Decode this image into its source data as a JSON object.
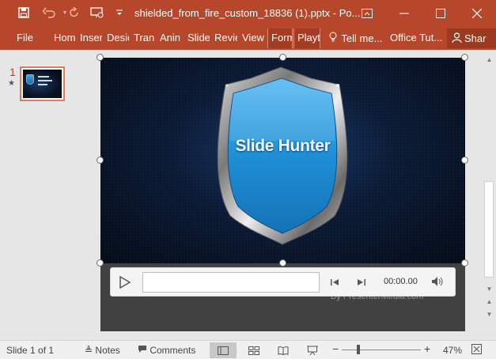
{
  "titlebar": {
    "title": "shielded_from_fire_custom_18836 (1).pptx - Po...",
    "icons": [
      "save-icon",
      "undo-icon",
      "redo-icon",
      "start-from-beginning-icon",
      "customize-qat-icon"
    ],
    "window": [
      "ribbon-display-icon",
      "minimize-icon",
      "maximize-icon",
      "close-icon"
    ]
  },
  "ribbon": {
    "tabs": {
      "file": "File",
      "home": "Hom",
      "insert": "Inser",
      "design": "Desic",
      "transitions": "Tran",
      "animations": "Anin",
      "slideshow": "Slide",
      "review": "Revie",
      "view": "View",
      "format": "Form",
      "playback": "Playt",
      "tellme": "Tell me...",
      "office_tutorials": "Office Tut...",
      "share": "Shar"
    }
  },
  "thumbnails": {
    "slide_number": "1",
    "star": "★"
  },
  "slide": {
    "shield_text": "Slide Hunter",
    "credit": "By PresenterMedia.com",
    "colors": {
      "shield_blue": "#1e8fd6",
      "background_dark": "#0a1428",
      "accent": "#b7472a"
    }
  },
  "media": {
    "time": "00:00.00",
    "progress": 0
  },
  "status": {
    "slide_info": "Slide 1 of 1",
    "notes": "Notes",
    "comments": "Comments",
    "zoom": "47%",
    "zoom_minus": "−",
    "zoom_plus": "+"
  }
}
